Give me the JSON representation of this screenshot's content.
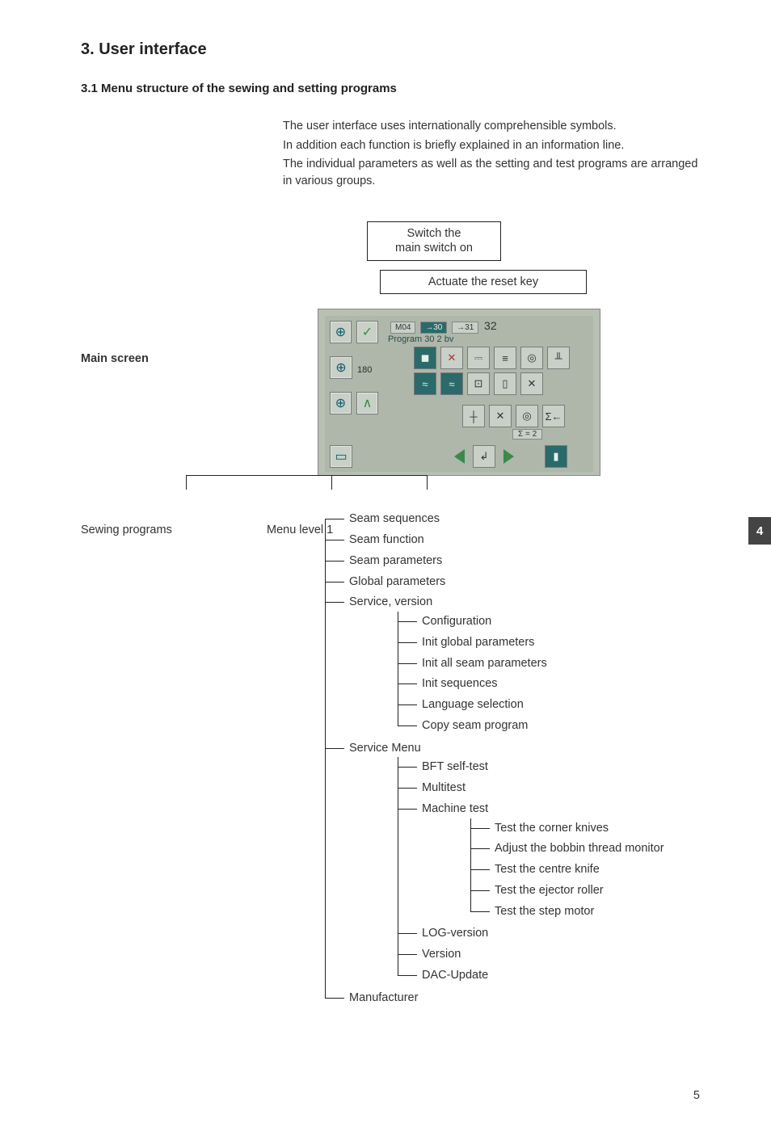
{
  "heading_main": "3.    User interface",
  "heading_sub": "3.1   Menu structure of the sewing and  setting programs",
  "intro": {
    "p1": "The user interface uses internationally comprehensible symbols.",
    "p2": "In addition each function is briefly explained in an information line.",
    "p3": "The individual parameters as well as the setting and test programs are arranged in various groups."
  },
  "flow": {
    "box1_line1": "Switch the",
    "box1_line2": "main switch on",
    "box2": "Actuate the reset key"
  },
  "main_screen_label": "Main screen",
  "screen": {
    "hdr_m": "M04",
    "hdr_a": "→30",
    "hdr_b": "→31",
    "hdr_c": "32",
    "program_line": "Program 30 2 bv",
    "left_num": "180",
    "sigma": "Σ = 2"
  },
  "tree_root_left": "Sewing programs",
  "tree_root_right": "Menu level 1",
  "tree": {
    "items": [
      {
        "label": "Seam sequences"
      },
      {
        "label": "Seam function"
      },
      {
        "label": "Seam parameters"
      },
      {
        "label": "Global parameters"
      },
      {
        "label": "Service, version",
        "children": [
          {
            "label": "Configuration"
          },
          {
            "label": "Init global parameters"
          },
          {
            "label": "Init all seam parameters"
          },
          {
            "label": "Init sequences"
          },
          {
            "label": "Language selection"
          },
          {
            "label": "Copy seam program"
          }
        ]
      },
      {
        "label": "Service Menu",
        "children": [
          {
            "label": "BFT self-test"
          },
          {
            "label": "Multitest"
          },
          {
            "label": "Machine test",
            "children": [
              {
                "label": "Test the corner knives"
              },
              {
                "label": "Adjust the bobbin thread monitor"
              },
              {
                "label": "Test the centre knife"
              },
              {
                "label": "Test the ejector roller"
              },
              {
                "label": "Test the step motor"
              }
            ]
          },
          {
            "label": "LOG-version"
          },
          {
            "label": "Version"
          },
          {
            "label": "DAC-Update"
          }
        ]
      },
      {
        "label": "Manufacturer"
      }
    ]
  },
  "side_tab": "4",
  "page_number": "5"
}
